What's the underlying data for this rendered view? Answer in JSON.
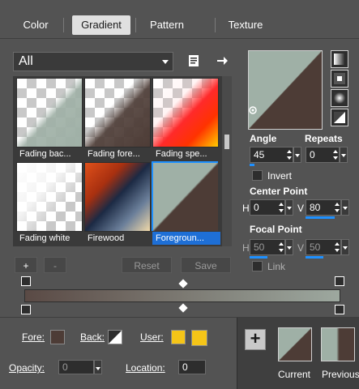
{
  "tabs": [
    {
      "label": "Color",
      "active": false
    },
    {
      "label": "Gradient",
      "active": true
    },
    {
      "label": "Pattern",
      "active": false
    },
    {
      "label": "Texture",
      "active": false
    }
  ],
  "category": {
    "value": "All"
  },
  "gallery": {
    "items": [
      {
        "label": "Fading bac..."
      },
      {
        "label": "Fading fore..."
      },
      {
        "label": "Fading spe..."
      },
      {
        "label": "Fading white"
      },
      {
        "label": "Firewood"
      },
      {
        "label": "Foregroun...",
        "selected": true
      }
    ]
  },
  "settings": {
    "angle_label": "Angle",
    "angle_value": "45",
    "repeats_label": "Repeats",
    "repeats_value": "0",
    "invert_label": "Invert",
    "center_point_label": "Center Point",
    "center_h_label": "H",
    "center_h_value": "0",
    "center_v_label": "V",
    "center_v_value": "80",
    "focal_point_label": "Focal Point",
    "focal_h_label": "H",
    "focal_h_value": "50",
    "focal_v_label": "V",
    "focal_v_value": "50",
    "link_label": "Link"
  },
  "buttons": {
    "add": "+",
    "remove": "-",
    "reset": "Reset",
    "save": "Save"
  },
  "stops": {
    "fore_label": "Fore:",
    "back_label": "Back:",
    "user_label": "User:",
    "opacity_label": "Opacity:",
    "opacity_value": "0",
    "location_label": "Location:",
    "location_value": "0"
  },
  "footer": {
    "add_button": "+",
    "current_label": "Current",
    "previous_label": "Previous"
  },
  "colors": {
    "foreground": "#4d3c36",
    "background": "#9fb0a6",
    "user": "#f5c518",
    "accent": "#1e90ff"
  }
}
